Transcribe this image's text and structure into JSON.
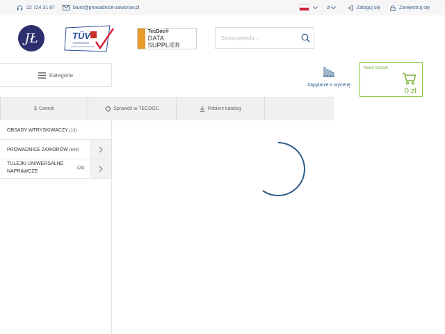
{
  "topbar": {
    "phone": "22 724 31 87",
    "email": "biuro@prowadnice-zaworow.pl",
    "currency": "zł",
    "login": "Zaloguj się",
    "register": "Zarejestruj się"
  },
  "header": {
    "logo_text": "JŁ",
    "tuv_brand": "TÜV",
    "tuv_sub": "THÜRINGEN",
    "tecdoc_line1": "TecDoc®",
    "tecdoc_line2": "DATA SUPPLIER",
    "search_placeholder": "Szukaj artykułu..."
  },
  "nav": {
    "categories_label": "Kategorie",
    "quote_label": "Zapytanie o wycenę",
    "cart_title": "Nowy koszyk",
    "cart_total": "0 zł"
  },
  "tools": [
    {
      "label": "Cennik",
      "icon": "dollar-icon"
    },
    {
      "label": "Sprawdź w TECDOC",
      "icon": "crosshair-icon"
    },
    {
      "label": "Pobierz katalog",
      "icon": "download-icon"
    }
  ],
  "categories": [
    {
      "label": "OBSADY WTRYSKIWACZY",
      "count": "(13)"
    },
    {
      "label": "PROWADNICE ZAWORÓW",
      "count": "(649)"
    },
    {
      "label": "TULEJKI UNIWERSALNE NAPRAWCZE",
      "count": "(29)"
    }
  ],
  "colors": {
    "accent_blue": "#2c5b86",
    "cart_green": "#8cc63e",
    "tecdoc_orange": "#e69b2b",
    "logo_navy": "#2d2e6e"
  }
}
